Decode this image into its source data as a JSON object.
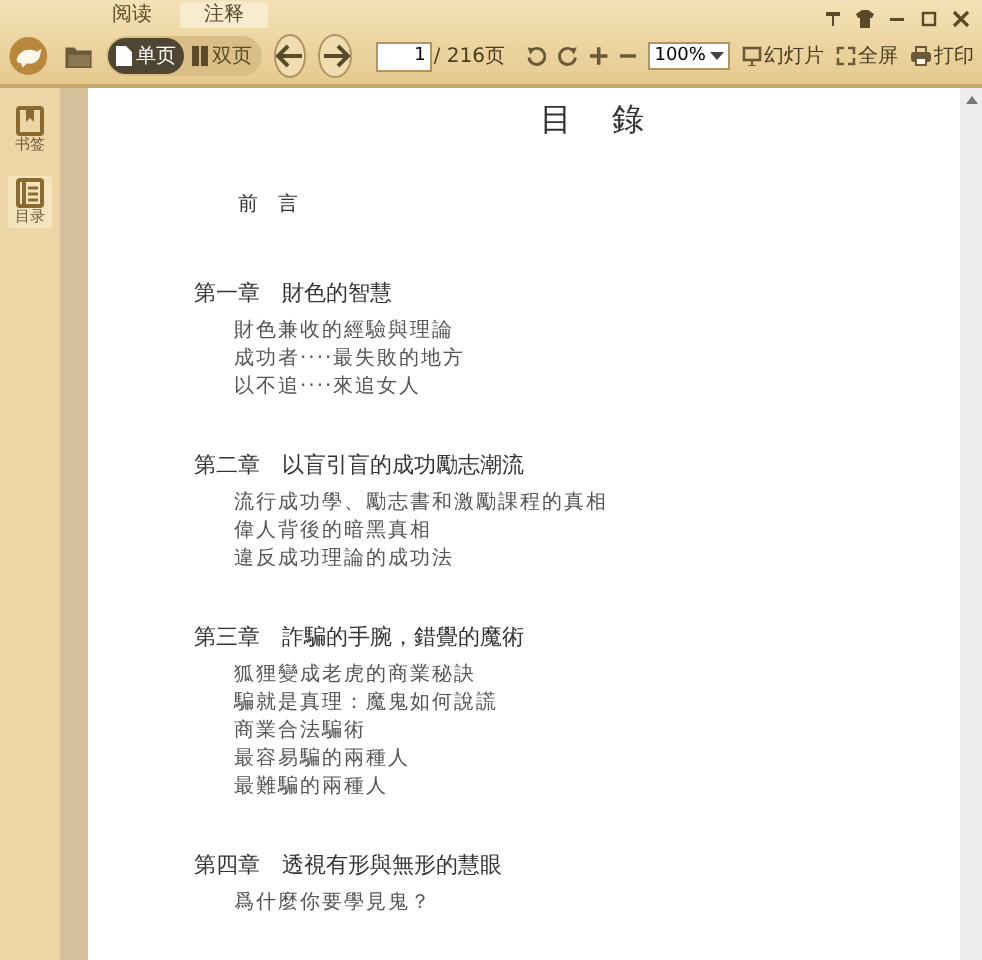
{
  "tabs": [
    {
      "label": "阅读",
      "selected": false
    },
    {
      "label": "注释",
      "selected": true
    }
  ],
  "toolbar": {
    "view_modes": [
      {
        "label": "单页",
        "selected": true
      },
      {
        "label": "双页",
        "selected": false
      }
    ],
    "page_input": "1",
    "page_total": "/ 216页",
    "zoom": "100%",
    "actions": [
      {
        "kind": "slideshow",
        "label": "幻灯片"
      },
      {
        "kind": "fullscreen",
        "label": "全屏"
      },
      {
        "kind": "print",
        "label": "打印"
      }
    ]
  },
  "sidebar": {
    "items": [
      {
        "kind": "bookmark",
        "label": "书签",
        "selected": false
      },
      {
        "kind": "toc",
        "label": "目录",
        "selected": true
      }
    ]
  },
  "document": {
    "title": "目　錄",
    "preface": "前　言",
    "chapters": [
      {
        "title": "第一章　財色的智慧",
        "items": [
          "財色兼收的經驗與理論",
          "成功者‧‧‧‧最失敗的地方",
          "以不追‧‧‧‧來追女人"
        ]
      },
      {
        "title": "第二章　以盲引盲的成功勵志潮流",
        "items": [
          "流行成功學、勵志書和激勵課程的真相",
          "偉人背後的暗黑真相",
          "違反成功理論的成功法"
        ]
      },
      {
        "title": "第三章　詐騙的手腕，錯覺的魔術",
        "items": [
          "狐狸變成老虎的商業秘訣",
          "騙就是真理：魔鬼如何說謊",
          "商業合法騙術",
          "最容易騙的兩種人",
          "最難騙的兩種人"
        ]
      },
      {
        "title": "第四章　透視有形與無形的慧眼",
        "items": [
          "爲什麼你要學見鬼？"
        ]
      }
    ]
  }
}
